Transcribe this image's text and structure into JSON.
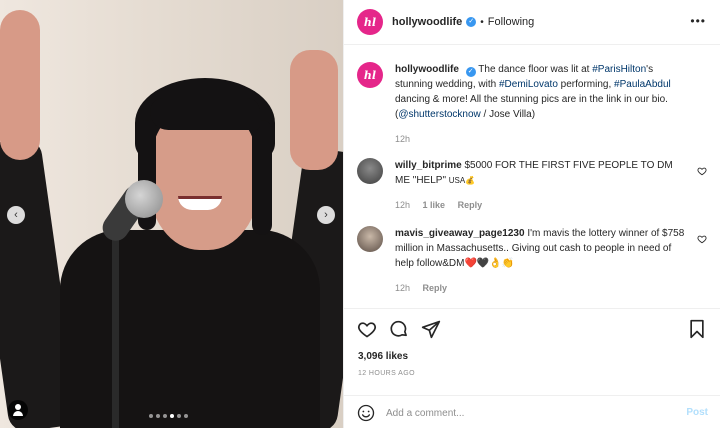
{
  "post": {
    "username": "hollywoodlife",
    "avatar_text": "hl",
    "follow_status": "Following",
    "separator": "•",
    "more_label": "•••"
  },
  "caption": {
    "username": "hollywoodlife",
    "text_before": "The dance floor was lit at ",
    "tag1": "#ParisHilton",
    "text_mid1": "'s stunning wedding, with ",
    "tag2": "#DemiLovato",
    "text_mid2": " performing, ",
    "tag3": "#PaulaAbdul",
    "text_after": " dancing & more! All the stunning pics are in the link in our bio. (",
    "mention": "@shutterstocknow",
    "credit": " / Jose Villa)",
    "time": "12h"
  },
  "comments": [
    {
      "username": "willy_bitprime",
      "text": "$5000 FOR THE FIRST FIVE PEOPLE TO DM ME \"HELP\" ",
      "suffix": "USA💰",
      "time": "12h",
      "likes": "1 like",
      "reply": "Reply"
    },
    {
      "username": "mavis_giveaway_page1230",
      "text": "I'm mavis the lottery winner of $758 million in Massachusetts.. Giving out cash to people in need of help follow&DM",
      "suffix": "❤️🖤👌👏",
      "time": "12h",
      "reply": "Reply"
    }
  ],
  "stats": {
    "likes": "3,096 likes",
    "time_ago": "12 HOURS AGO"
  },
  "comment_box": {
    "placeholder": "Add a comment...",
    "post_label": "Post"
  },
  "carousel": {
    "prev": "‹",
    "next": "›",
    "dots": 6,
    "active_dot": 3
  },
  "colors": {
    "brand": "#e5268a",
    "verified": "#3897f0",
    "link": "#00376b",
    "post_disabled": "#b2dffc"
  }
}
